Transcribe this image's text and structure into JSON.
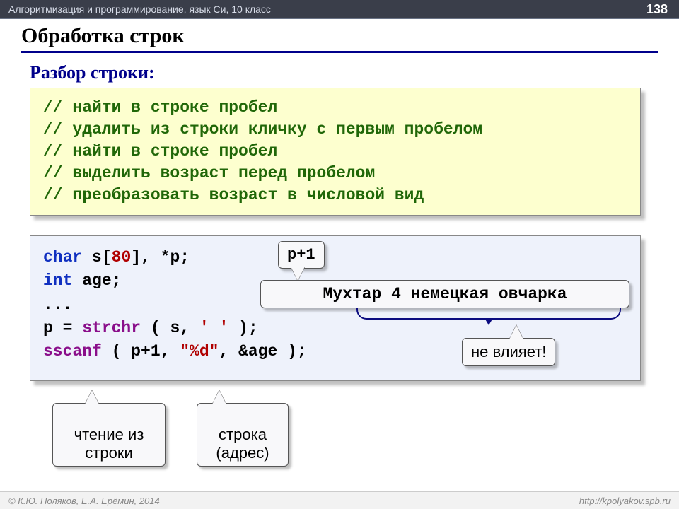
{
  "header": {
    "breadcrumb": "Алгоритмизация и программирование, язык Си, 10 класс",
    "page_number": "138"
  },
  "title": "Обработка строк",
  "subtitle": "Разбор строки:",
  "comments": {
    "c1": "// найти в строке пробел",
    "c2": "// удалить из строки кличку с первым пробелом",
    "c3": "// найти в строке пробел",
    "c4": "// выделить возраст перед пробелом",
    "c5": "// преобразовать возраст в числовой вид"
  },
  "code": {
    "kw_char": "char",
    "decl_rest": " s[",
    "num80": "80",
    "decl_rest2": "], *p;",
    "kw_int": "int",
    "decl_age": " age;",
    "dots": "...",
    "p_eq": "p = ",
    "fn_strchr": "strchr",
    "strchr_args_a": " ( s, ",
    "strchr_space": "' '",
    "strchr_args_b": " );",
    "fn_sscanf": "sscanf",
    "sscanf_args_a": " ( p+1, ",
    "fmt": "\"%d\"",
    "sscanf_args_b": ", &age );"
  },
  "callouts": {
    "p_plus_1": "p+1",
    "example": "Мухтар 4 немецкая овчарка",
    "no_effect": "не влияет!",
    "read_from_str": "чтение из\nстроки",
    "string_addr": "строка\n(адрес)"
  },
  "footer": {
    "left": "© К.Ю. Поляков, Е.А. Ерёмин, 2014",
    "right": "http://kpolyakov.spb.ru"
  }
}
